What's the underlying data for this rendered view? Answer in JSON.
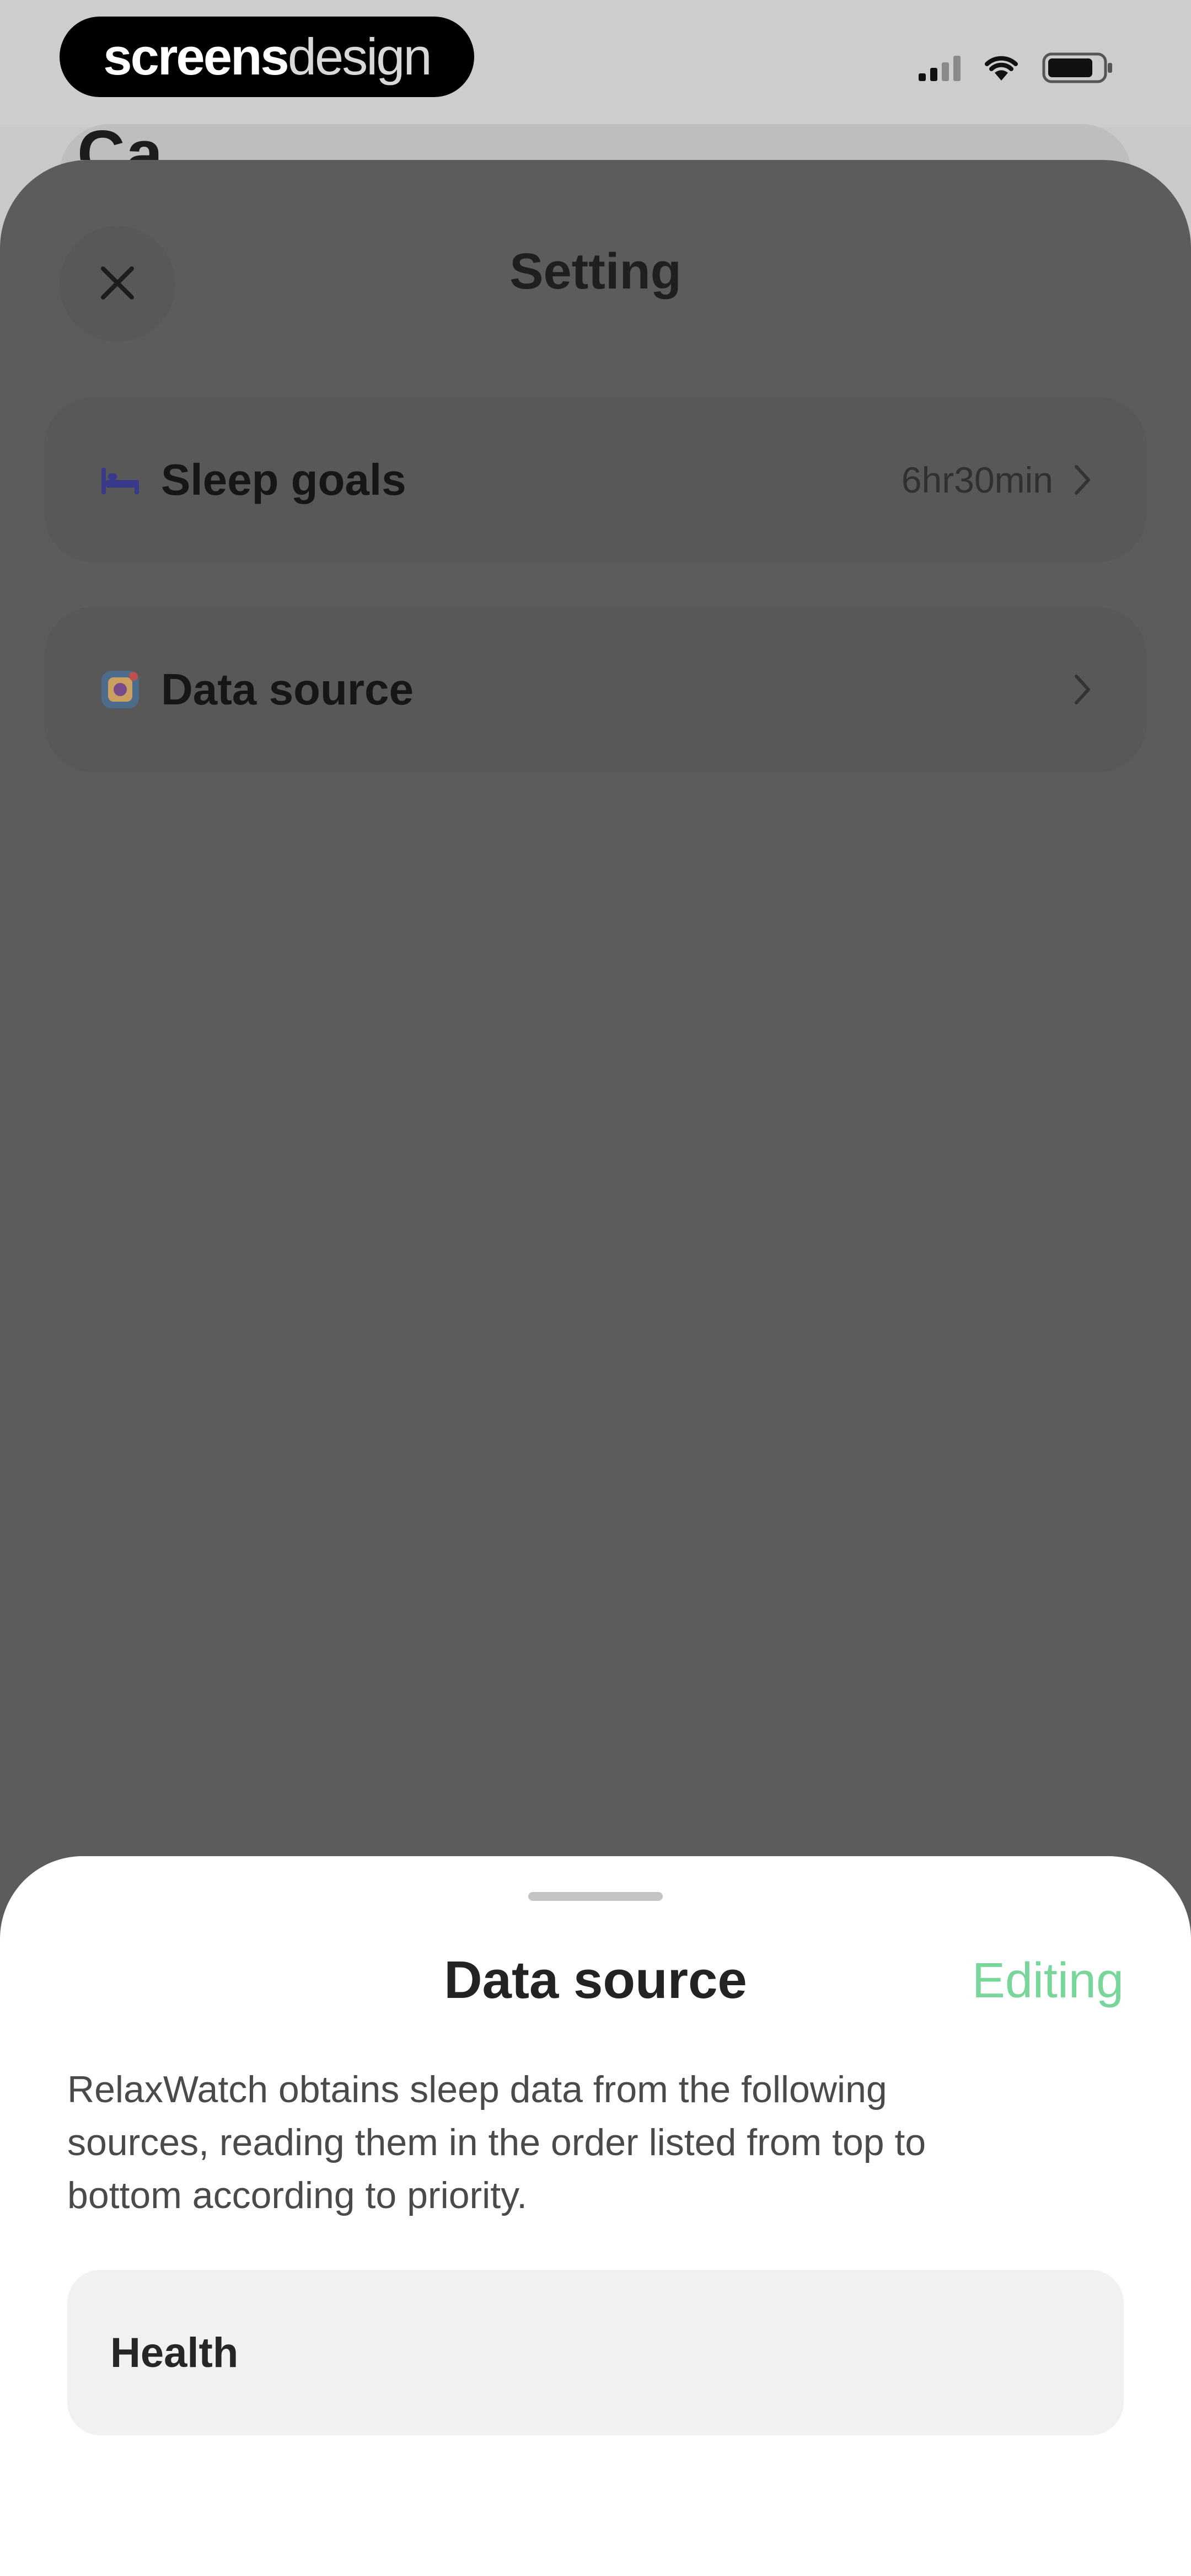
{
  "status_bar": {
    "watermark_bold": "screens",
    "watermark_light": "design"
  },
  "background_page": {
    "title_fragment": "Ca..."
  },
  "settings_sheet": {
    "title": "Setting",
    "rows": [
      {
        "label": "Sleep goals",
        "value": "6hr30min",
        "icon": "bed-icon"
      },
      {
        "label": "Data source",
        "value": "",
        "icon": "data-source-app-icon"
      }
    ]
  },
  "bottom_sheet": {
    "title": "Data source",
    "edit_label": "Editing",
    "description": "RelaxWatch obtains sleep data from the following sources, reading them in the order listed from top to bottom according to priority.",
    "sources": [
      "Health"
    ]
  },
  "colors": {
    "accent": "#79d69b",
    "dim_overlay": "#5c5c5c",
    "sheet_background": "#ffffff",
    "source_item_background": "#f1f1f3",
    "bed_icon": "#3a3a8a"
  }
}
